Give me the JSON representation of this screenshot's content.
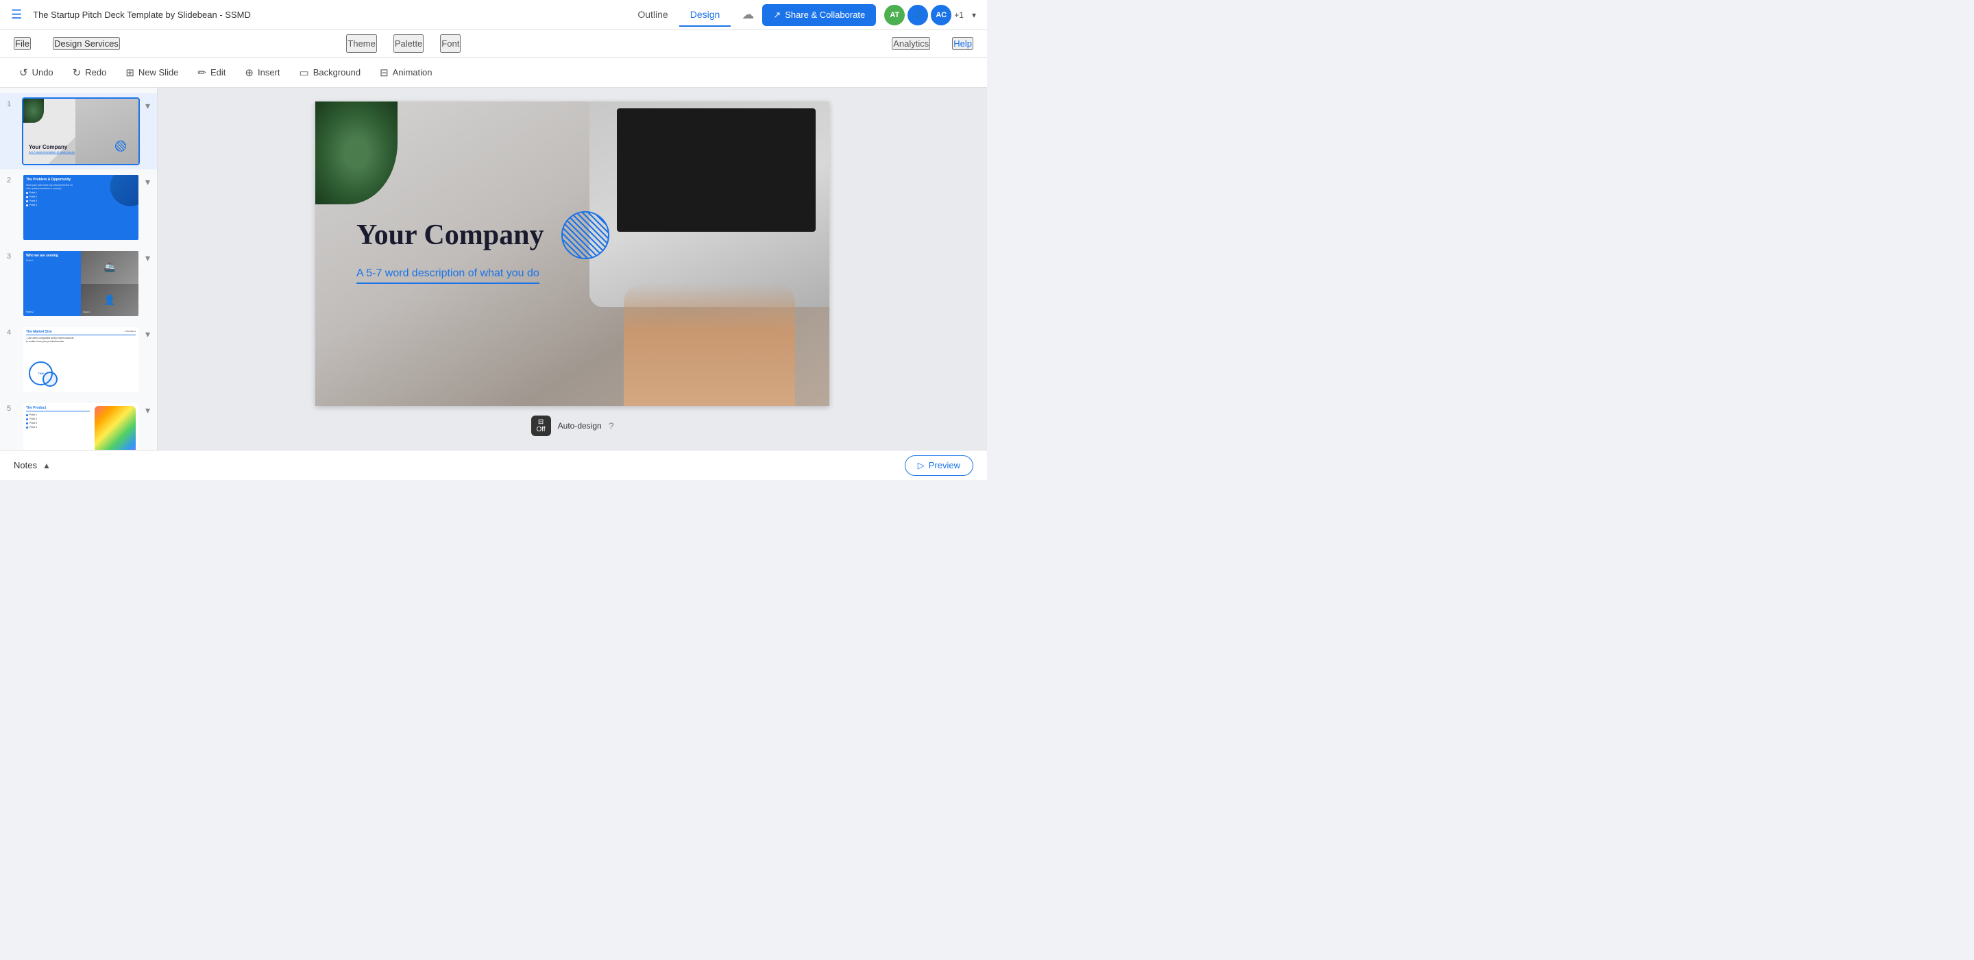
{
  "app": {
    "title": "The Startup Pitch Deck Template by Slidebean - SSMD",
    "hamburger": "≡"
  },
  "top_nav": {
    "outline": "Outline",
    "design": "Design"
  },
  "top_right": {
    "share_label": "Share & Collaborate",
    "avatar1": "AT",
    "avatar2": "AC",
    "plus_count": "+1"
  },
  "second_bar": {
    "file": "File",
    "design_services": "Design Services",
    "theme": "Theme",
    "palette": "Palette",
    "font": "Font",
    "analytics": "Analytics",
    "help": "Help"
  },
  "toolbar": {
    "undo": "Undo",
    "redo": "Redo",
    "new_slide": "New Slide",
    "edit": "Edit",
    "insert": "Insert",
    "background": "Background",
    "animation": "Animation"
  },
  "slides": [
    {
      "num": "1",
      "label": "Your Company slide",
      "title": "Your Company",
      "subtitle": "A 5-7 word description of what you do"
    },
    {
      "num": "2",
      "label": "The Problem & Opportunity slide"
    },
    {
      "num": "3",
      "label": "Who we are serving ship scale slide"
    },
    {
      "num": "4",
      "label": "The Market Size slide",
      "tam_label": "TAM"
    },
    {
      "num": "5",
      "label": "The Product slide",
      "title": "The Product",
      "points": [
        "Point 1",
        "Point 2",
        "Point 3",
        "Point 4"
      ]
    }
  ],
  "canvas": {
    "company_title": "Your Company",
    "company_subtitle": "A 5-7 word description of what you do"
  },
  "bottom": {
    "notes_label": "Notes",
    "auto_design_off": "Off",
    "auto_design_label": "Auto-design",
    "preview_label": "Preview"
  }
}
